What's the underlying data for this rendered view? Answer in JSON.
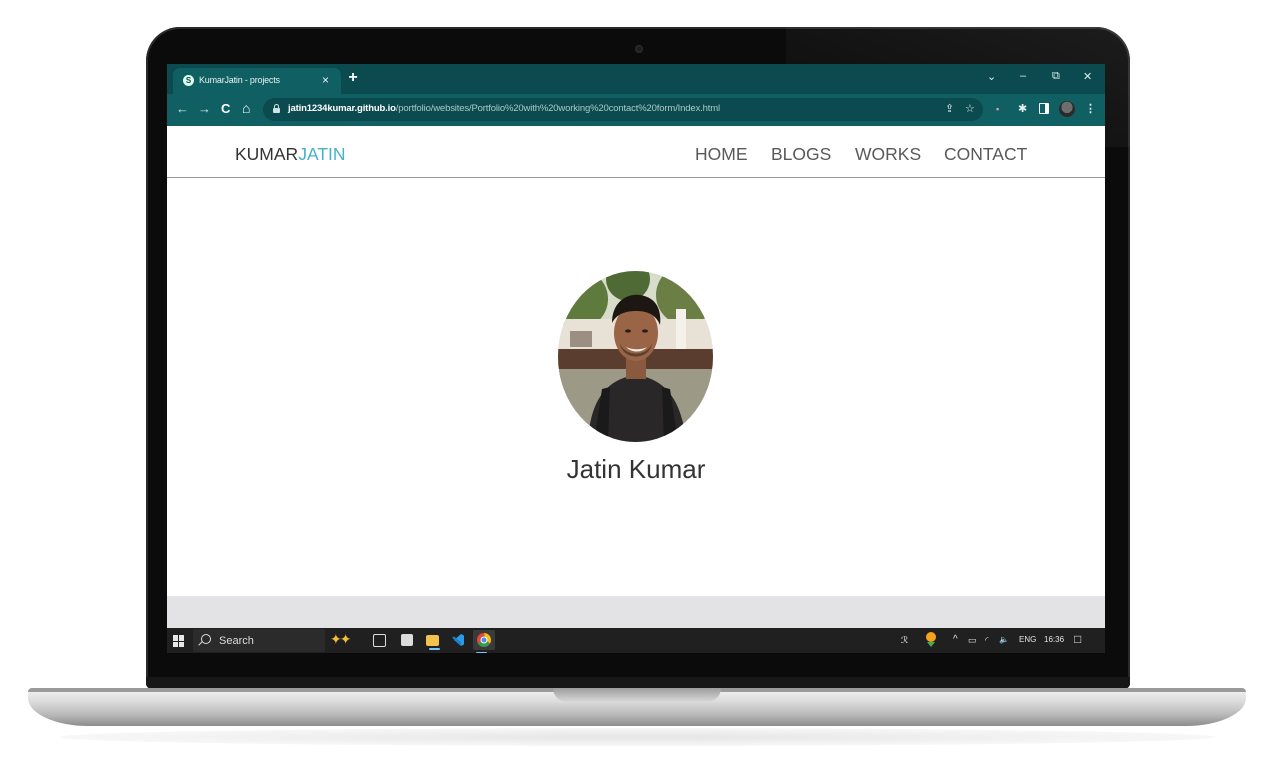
{
  "browser": {
    "tab": {
      "favicon_icon": "site-favicon-icon",
      "title": "KumarJatin - projects",
      "close_label": "×"
    },
    "new_tab_label": "+",
    "window_controls": {
      "tab_search": "⌄",
      "minimize": "–",
      "restore": "⧉",
      "close": "✕"
    },
    "toolbar": {
      "back": "←",
      "forward": "→",
      "reload": "C",
      "home": "⌂",
      "url_host": "jatin1234kumar.github.io",
      "url_path": "/portfolio/websites/Portfolio%20with%20working%20contact%20form/Index.html",
      "share": "⇪",
      "bookmark": "☆",
      "extension": "▪",
      "extensions_puzzle": "✱",
      "menu": "⋮"
    }
  },
  "site": {
    "logo_part1": "KUMAR",
    "logo_part2": "JATIN",
    "accent_color": "#45b2c6",
    "nav": [
      "HOME",
      "BLOGS",
      "WORKS",
      "CONTACT"
    ],
    "profile_photo_alt": "profile-photo",
    "name": "Jatin Kumar"
  },
  "taskbar": {
    "search_placeholder": "Search",
    "tray": {
      "people": "ℛ",
      "chevron": "^",
      "battery": "▭",
      "network": "◜",
      "volume": "🔈",
      "language": "ENG",
      "time": "16:36",
      "notifications": "□"
    }
  }
}
